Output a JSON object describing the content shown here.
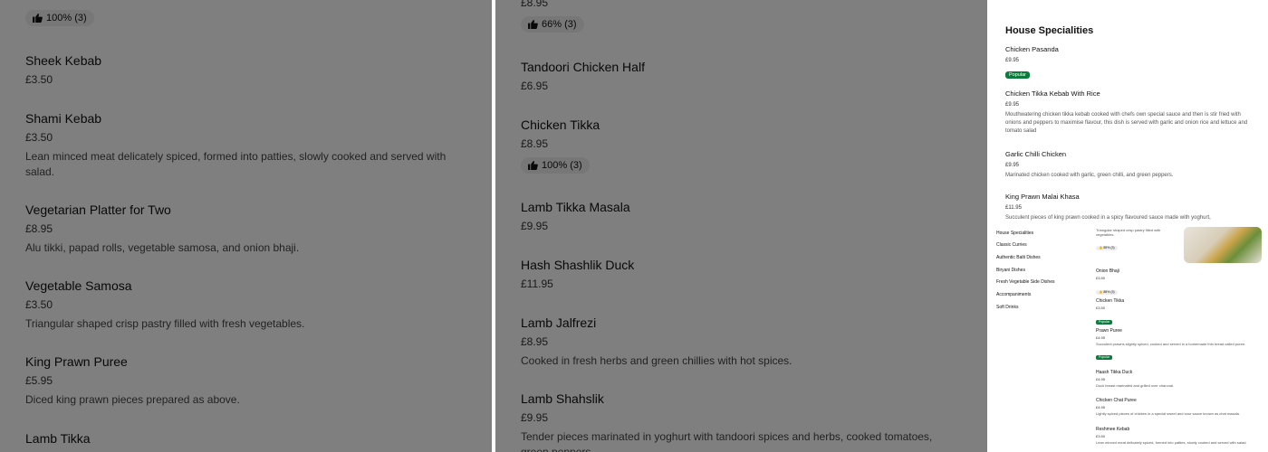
{
  "left_panel": {
    "top_rating": "100% (3)",
    "items": [
      {
        "name": "Sheek Kebab",
        "price": "£3.50",
        "desc": ""
      },
      {
        "name": "Shami Kebab",
        "price": "£3.50",
        "desc": "Lean minced meat delicately spiced, formed into patties, slowly cooked and served with salad."
      },
      {
        "name": "Vegetarian Platter for Two",
        "price": "£8.95",
        "desc": "Alu tikki, papad rolls, vegetable samosa, and onion bhaji."
      },
      {
        "name": "Vegetable Samosa",
        "price": "£3.50",
        "desc": "Triangular shaped crisp pastry filled with fresh vegetables."
      },
      {
        "name": "King Prawn Puree",
        "price": "£5.95",
        "desc": "Diced king prawn pieces prepared as above."
      },
      {
        "name": "Lamb Tikka",
        "price": "",
        "desc": ""
      }
    ]
  },
  "mid_panel": {
    "top_price": "£8.95",
    "top_rating": "66% (3)",
    "items": [
      {
        "name": "Tandoori Chicken Half",
        "price": "£6.95",
        "desc": "",
        "rating": ""
      },
      {
        "name": "Chicken Tikka",
        "price": "£8.95",
        "desc": "",
        "rating": "100% (3)"
      },
      {
        "name": "Lamb Tikka Masala",
        "price": "£9.95",
        "desc": "",
        "rating": ""
      },
      {
        "name": "Hash Shashlik Duck",
        "price": "£11.95",
        "desc": "",
        "rating": ""
      },
      {
        "name": "Lamb Jalfrezi",
        "price": "£8.95",
        "desc": "Cooked in fresh herbs and green chillies with hot spices.",
        "rating": ""
      },
      {
        "name": "Lamb Shahslik",
        "price": "£9.95",
        "desc": "Tender pieces marinated in yoghurt with tandoori spices and herbs, cooked tomatoes, green peppers.",
        "rating": ""
      }
    ]
  },
  "right_top_panel": {
    "heading": "House Specialities",
    "items": [
      {
        "name": "Chicken Pasanda",
        "price": "£9.95",
        "desc": "",
        "badge": "Popular"
      },
      {
        "name": "Chicken Tikka Kebab With Rice",
        "price": "£9.95",
        "desc": "Mouthwatering chicken tikka kebab cooked with chefs own special sauce and then is stir fried with onions and peppers to maximise flavour, this dish is served with garlic and onion rice and lettuce and tomato salad",
        "badge": ""
      },
      {
        "name": "Garlic Chilli Chicken",
        "price": "£9.95",
        "desc": "Marinated chicken cooked with garlic, green chilli, and green peppers.",
        "badge": ""
      },
      {
        "name": "King Prawn Malai Khasa",
        "price": "£11.95",
        "desc": "Succulent pieces of king prawn cooked in a spicy flavoured sauce made with yoghurt,",
        "badge": ""
      }
    ]
  },
  "right_bottom_panel": {
    "categories": [
      "House Specialities",
      "Classic Curries",
      "Authentic Balti Dishes",
      "Biryani Dishes",
      "Fresh Vegetable Side Dishes",
      "Accompaniments",
      "Soft Drinks"
    ],
    "top_desc": "Triangular shaped crisp pastry filled with vegetables.",
    "top_rating": "85% (3)",
    "items": [
      {
        "name": "Onion Bhaji",
        "price": "£3.50",
        "desc": "",
        "badge": "",
        "rating": "88% (3)"
      },
      {
        "name": "Chicken Tikka",
        "price": "£3.50",
        "desc": "",
        "badge": "Popular",
        "rating": ""
      },
      {
        "name": "Prawn Puree",
        "price": "£4.95",
        "desc": "Succulent prawns slightly spiced, cooked and served in a homemade thin bread called puree.",
        "badge": "Popular",
        "rating": ""
      },
      {
        "name": "Haash Tikka Duck",
        "price": "£4.95",
        "desc": "Duck breast marinated and grilled over charcoal.",
        "badge": "",
        "rating": ""
      },
      {
        "name": "Chicken Chat Puree",
        "price": "£4.95",
        "desc": "Lightly spiced pieces of chicken in a special sweet and sour sauce known as chat masala.",
        "badge": "",
        "rating": ""
      },
      {
        "name": "Reshmee Kebab",
        "price": "£3.50",
        "desc": "Lean minced meat delicately spiced, formed into patties, slowly cooked and served with salad.",
        "badge": "",
        "rating": ""
      }
    ]
  },
  "colors": {
    "scrim": "rgba(0,0,0,0.5)",
    "popular_badge": "#0b7a3a"
  },
  "icons": {
    "rating": "thumbs-up-icon"
  }
}
